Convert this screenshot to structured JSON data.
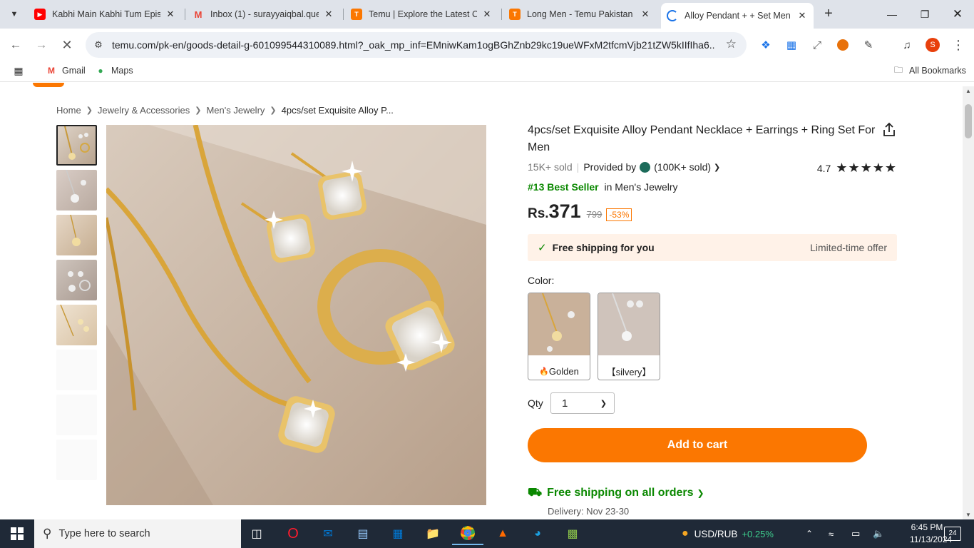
{
  "browser": {
    "tabs": [
      {
        "title": "Kabhi Main Kabhi Tum Episo",
        "icon": "youtube-icon",
        "color": "#ff0000"
      },
      {
        "title": "Inbox (1) - surayyaiqbal.que",
        "icon": "gmail-icon",
        "color": "#ea4335"
      },
      {
        "title": "Temu | Explore the Latest Clo",
        "icon": "temu-icon",
        "color": "#fb7701"
      },
      {
        "title": "Long Men - Temu Pakistan",
        "icon": "temu-icon",
        "color": "#fb7701"
      },
      {
        "title": "Alloy Pendant + + Set Men -",
        "icon": "loading-icon",
        "color": "#1a73e8"
      }
    ],
    "url": "temu.com/pk-en/goods-detail-g-601099544310089.html?_oak_mp_inf=EMniwKam1ogBGhZnb29kc19ueWFxM2tfcmVjb21tZW5kIIfIha6...",
    "profile_initial": "S",
    "bookmarks": {
      "gmail": "Gmail",
      "maps": "Maps",
      "all": "All Bookmarks"
    }
  },
  "breadcrumb": {
    "home": "Home",
    "cat1": "Jewelry & Accessories",
    "cat2": "Men's Jewelry",
    "current": "4pcs/set Exquisite Alloy P..."
  },
  "product": {
    "title": "4pcs/set Exquisite Alloy Pendant Necklace + Earrings + Ring Set For Men",
    "sold": "15K+ sold",
    "provided_by": "Provided by",
    "seller_sold": "(100K+ sold)",
    "rating": "4.7",
    "rank": "#13 Best Seller",
    "rank_category": "in Men's Jewelry",
    "currency": "Rs.",
    "price": "371",
    "old_price": "799",
    "discount": "-53%",
    "shipping_banner": "Free shipping for you",
    "limited": "Limited-time offer",
    "color_label": "Color:",
    "colors": [
      {
        "name": "Golden",
        "prefix": "🔥"
      },
      {
        "name": "【silvery】",
        "prefix": ""
      }
    ],
    "qty_label": "Qty",
    "qty_value": "1",
    "add_to_cart": "Add to cart",
    "free_all": "Free shipping on all orders",
    "delivery": "Delivery: Nov 23-30"
  },
  "taskbar": {
    "search_placeholder": "Type here to search",
    "currency_pair": "USD/RUB",
    "currency_change": "+0.25%",
    "time": "6:45 PM",
    "date": "11/13/2024",
    "notifications": "24"
  }
}
